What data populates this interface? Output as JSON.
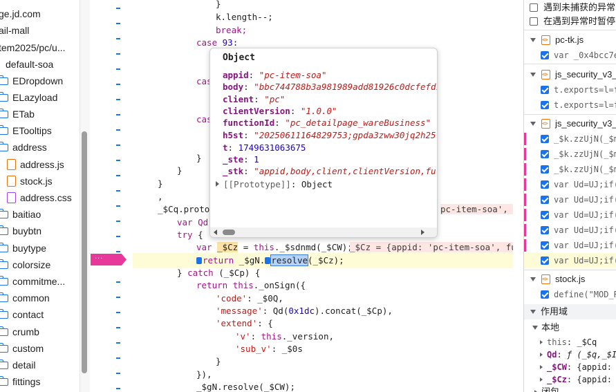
{
  "file_tree": {
    "items": [
      {
        "label": "ge.jd.com",
        "kind": "none"
      },
      {
        "label": "ail-mall",
        "kind": "none"
      },
      {
        "label": "tem2025/pc/u...",
        "kind": "none"
      },
      {
        "label": "default-soa",
        "kind": "none"
      },
      {
        "label": "EDropdown",
        "kind": "folder"
      },
      {
        "label": "ELazyload",
        "kind": "folder"
      },
      {
        "label": "ETab",
        "kind": "folder"
      },
      {
        "label": "ETooltips",
        "kind": "folder"
      },
      {
        "label": "address",
        "kind": "folder"
      },
      {
        "label": "address.js",
        "kind": "file-js"
      },
      {
        "label": "stock.js",
        "kind": "file-js"
      },
      {
        "label": "address.css",
        "kind": "file-css"
      },
      {
        "label": "baitiao",
        "kind": "folder"
      },
      {
        "label": "buybtn",
        "kind": "folder"
      },
      {
        "label": "buytype",
        "kind": "folder"
      },
      {
        "label": "colorsize",
        "kind": "folder"
      },
      {
        "label": "commitme...",
        "kind": "folder"
      },
      {
        "label": "common",
        "kind": "folder"
      },
      {
        "label": "contact",
        "kind": "folder"
      },
      {
        "label": "crumb",
        "kind": "folder"
      },
      {
        "label": "custom",
        "kind": "folder"
      },
      {
        "label": "detail",
        "kind": "folder"
      },
      {
        "label": "fittings",
        "kind": "folder"
      }
    ]
  },
  "breakpoint_gutter_label": "...",
  "editor": {
    "line_1": "}",
    "line_2_a": "k.length--",
    "line_2_b": ";",
    "line_3": "break;",
    "line_4_kw": "case",
    "line_4_num": "93",
    "line_4_end": ":",
    "case_kw_1": "cas",
    "case_kw_2": "cas",
    "brace_a": "}",
    "brace_b": "}",
    "brace_c": "}",
    "comma": ",",
    "proto_line": "_$Cq.protot",
    "proto_tail": "pc-item-soa', fun",
    "var_qd": "var Qd",
    "try_kw": "try",
    "try_brace": "{",
    "cz_var": "var",
    "cz_name": "_$Cz",
    "cz_eq": " = ",
    "cz_this": "this",
    "cz_call": "._$sdnmd(_$CW);",
    "cz_inline": "_$Cz = {appid: 'pc-item-soa', fun",
    "ret_kw": "return",
    "ret_obj": " _$gN.",
    "ret_fn": "resolve",
    "ret_arg": "(_$Cz);",
    "catch_open": "} ",
    "catch_kw": "catch",
    "catch_arg": " (_$Cp) {",
    "ret2_kw": "return",
    "ret2_this": "this",
    "ret2_call": "._onSign({",
    "code_key": "'code'",
    "code_val": ": _$0Q,",
    "msg_key": "'message'",
    "msg_val_a": ": Qd(",
    "msg_num": "0x1dc",
    "msg_val_b": ").concat(_$Cp),",
    "extend_key": "'extend'",
    "extend_val": ": {",
    "v_key": "'v'",
    "v_sep": ": ",
    "v_this": "this",
    "v_val": "._version,",
    "subv_key": "'sub_v'",
    "subv_val": ": _$0s",
    "close_obj": "}",
    "close_call": "}),",
    "last_line": "_$gN.resolve(_$CW);"
  },
  "popover": {
    "title": "Object",
    "props": [
      {
        "key": "appid",
        "value": "\"pc-item-soa\"",
        "type": "string"
      },
      {
        "key": "body",
        "value": "\"bbc744788b3a981989add81926c0dcfefd1",
        "type": "string"
      },
      {
        "key": "client",
        "value": "\"pc\"",
        "type": "string"
      },
      {
        "key": "clientVersion",
        "value": "\"1.0.0\"",
        "type": "string"
      },
      {
        "key": "functionId",
        "value": "\"pc_detailpage_wareBusiness\"",
        "type": "string"
      },
      {
        "key": "h5st",
        "value": "\"20250611164829753;gpda3zww30jq2h25;",
        "type": "string"
      },
      {
        "key": "t",
        "value": "1749631063675",
        "type": "number"
      },
      {
        "key": "_ste",
        "value": "1",
        "type": "number"
      },
      {
        "key": "_stk",
        "value": "\"appid,body,client,clientVersion,fur",
        "type": "string"
      }
    ],
    "prototype_label": "[[Prototype]]",
    "prototype_value": "Object"
  },
  "right_panel": {
    "pause_uncaught": "遇到未捕获的异常",
    "pause_caught": "在遇到异常时暂停",
    "groups": [
      {
        "file": "pc-tk.js",
        "lines": [
          {
            "text": "var _0x4bcc7e",
            "checked": true,
            "pink": false
          }
        ]
      },
      {
        "file": "js_security_v3_",
        "lines": [
          {
            "text": "t.exports=l=f",
            "checked": true,
            "pink": false
          },
          {
            "text": "t.exports=l=f",
            "checked": true,
            "pink": false
          }
        ]
      },
      {
        "file": "js_security_v3_",
        "lines": [
          {
            "text": "_$k.zzUjN(_$m",
            "checked": true,
            "pink": true
          },
          {
            "text": "_$k.zzUjN(_$m",
            "checked": true,
            "pink": true
          },
          {
            "text": "_$k.zzUjN(_$m",
            "checked": true,
            "pink": true
          },
          {
            "text": "var Ud=UJ;if(",
            "checked": true,
            "pink": true
          },
          {
            "text": "var Ud=UJ;if(",
            "checked": true,
            "pink": true
          },
          {
            "text": "var Ud=UJ;if(",
            "checked": true,
            "pink": true
          },
          {
            "text": "var Ud=UJ;if(",
            "checked": true,
            "pink": true
          },
          {
            "text": "var Ud=UJ;if(",
            "checked": true,
            "pink": true
          },
          {
            "text": "var Ud=UJ;if(",
            "checked": true,
            "pink": false,
            "selected": true
          }
        ]
      },
      {
        "file": "stock.js",
        "lines": [
          {
            "text": "define(\"MOD_R",
            "checked": true,
            "pink": false
          }
        ]
      }
    ],
    "scope_title": "作用域",
    "local_label": "本地",
    "scope_items": [
      {
        "key": "this",
        "value": "_$Cq",
        "strong": false
      },
      {
        "key": "Qd",
        "value": "ƒ (_$q,_$I",
        "strong": true
      },
      {
        "key": "_$CW",
        "value": "{appid:",
        "strong": true
      },
      {
        "key": "_$Cz",
        "value": "{appid:",
        "strong": true
      }
    ],
    "closure_label": "闭包"
  }
}
